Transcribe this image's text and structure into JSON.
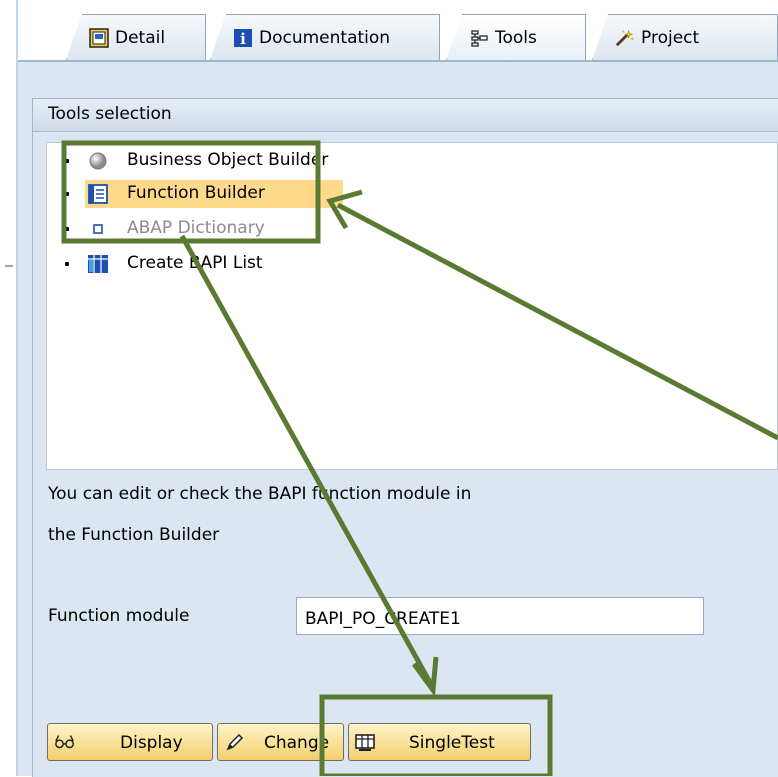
{
  "tabs": [
    {
      "label": "Detail",
      "icon": "detail-icon"
    },
    {
      "label": "Documentation",
      "icon": "info-icon"
    },
    {
      "label": "Tools",
      "icon": "tools-icon",
      "active": true
    },
    {
      "label": "Project",
      "icon": "project-wand-icon"
    }
  ],
  "panel": {
    "title": "Tools selection",
    "tree": [
      {
        "label": "Business Object Builder",
        "icon": "business-object-icon",
        "state": "normal"
      },
      {
        "label": "Function Builder",
        "icon": "function-builder-icon",
        "state": "selected"
      },
      {
        "label": "ABAP Dictionary",
        "icon": "dictionary-icon",
        "state": "disabled"
      },
      {
        "label": "Create BAPI List",
        "icon": "bapi-list-icon",
        "state": "normal"
      }
    ],
    "description_line1": "You can edit or check the BAPI function module in",
    "description_line2": "the Function Builder",
    "function_module_label": "Function module",
    "function_module_value": "BAPI_PO_CREATE1"
  },
  "buttons": {
    "display_label": "Display",
    "change_label": "Change",
    "single_test_label": "SingleTest"
  },
  "colors": {
    "annotation_green": "#5a7a32",
    "selection_highlight": "#ffd98a",
    "panel_bg": "#dbe6f2",
    "button_gold": "#f3cf6b"
  }
}
